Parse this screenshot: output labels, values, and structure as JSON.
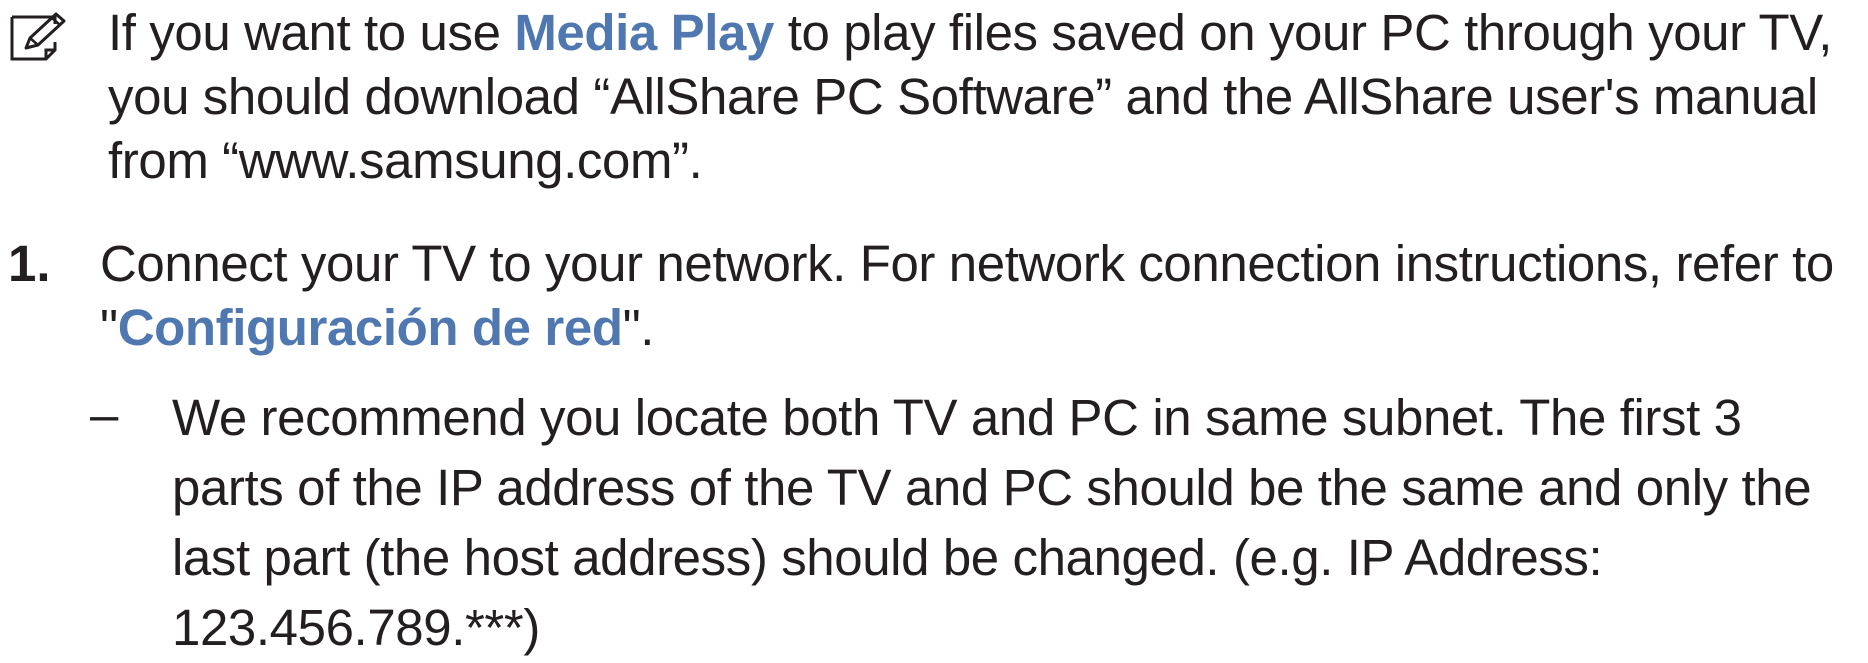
{
  "note": {
    "icon": "note-pencil-icon",
    "before_link": "If you want to use ",
    "link": "Media Play",
    "after_link": " to play files saved on your PC through your TV, you should download “AllShare PC Software” and the AllShare user's manual from “www.samsung.com”."
  },
  "step1": {
    "number": "1.",
    "before_link": "Connect your TV to your network. For network connection instructions, refer to \"",
    "link": "Configuración de red",
    "after_link": "\"."
  },
  "sub_item": {
    "bullet": "–",
    "text": "We recommend you locate both TV and PC in same subnet. The first 3 parts of the IP address of the TV and PC should be the same and only the last part (the host address) should be changed. (e.g. IP Address: 123.456.789.***)"
  },
  "colors": {
    "link": "#4f77b0",
    "text": "#231f20"
  }
}
